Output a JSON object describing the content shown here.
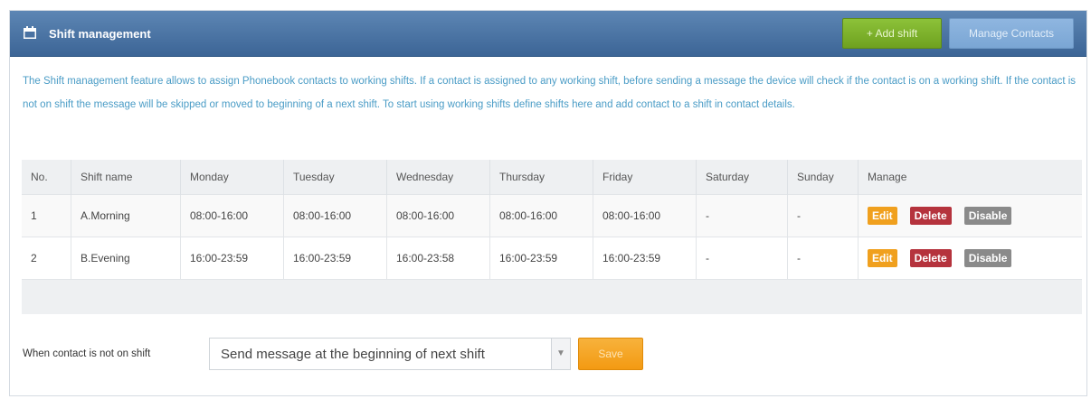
{
  "header": {
    "title": "Shift management",
    "icon": "calendar-icon",
    "add_shift_label": "+ Add shift",
    "manage_contacts_label": "Manage Contacts",
    "bg_color": "#4a72a2",
    "add_color": "#7db22b"
  },
  "description": "The Shift management feature allows to assign Phonebook contacts to working shifts. If a contact is assigned to any working shift, before sending a message the device will check if the contact is on a working shift. If the contact is not on shift the message will be skipped or moved to beginning of a next shift. To start using working shifts define shifts here and add contact to a shift in contact details.",
  "table": {
    "headers": {
      "no": "No.",
      "name": "Shift name",
      "mon": "Monday",
      "tue": "Tuesday",
      "wed": "Wednesday",
      "thu": "Thursday",
      "fri": "Friday",
      "sat": "Saturday",
      "sun": "Sunday",
      "manage": "Manage"
    },
    "rows": [
      {
        "no": "1",
        "name": "A.Morning",
        "mon": "08:00-16:00",
        "tue": "08:00-16:00",
        "wed": "08:00-16:00",
        "thu": "08:00-16:00",
        "fri": "08:00-16:00",
        "sat": "-",
        "sun": "-",
        "edit": "Edit",
        "delete": "Delete",
        "disable": "Disable"
      },
      {
        "no": "2",
        "name": "B.Evening",
        "mon": "16:00-23:59",
        "tue": "16:00-23:59",
        "wed": "16:00-23:58",
        "thu": "16:00-23:59",
        "fri": "16:00-23:59",
        "sat": "-",
        "sun": "-",
        "edit": "Edit",
        "delete": "Delete",
        "disable": "Disable"
      }
    ]
  },
  "footer": {
    "label": "When contact is not on shift",
    "selected_option": "Send message at the beginning of next shift",
    "save_label": "Save"
  },
  "colors": {
    "edit": "#f0a01e",
    "delete": "#b5333d",
    "disable": "#8a8a8a",
    "save": "#f5a623"
  }
}
